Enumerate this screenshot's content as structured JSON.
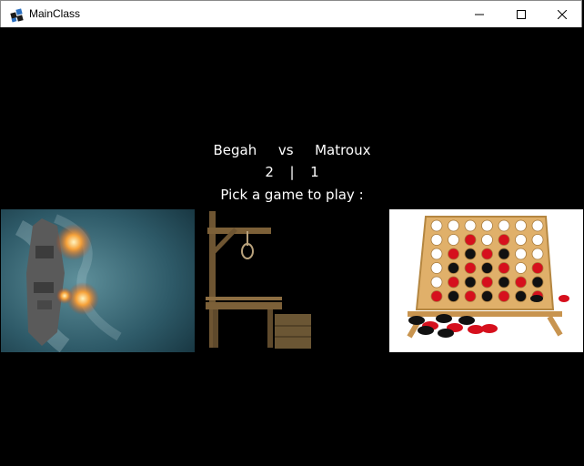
{
  "window": {
    "title": "MainClass",
    "icons": {
      "app": "java-app-icon",
      "minimize": "minimize-icon",
      "maximize": "maximize-icon",
      "close": "close-icon"
    }
  },
  "players": {
    "player1": "Begah",
    "separator": "vs",
    "player2": "Matroux"
  },
  "score": {
    "player1": "2",
    "divider": "|",
    "player2": "1"
  },
  "prompt": "Pick a game to play :",
  "games": [
    {
      "id": "battleship",
      "image": "battleship-image"
    },
    {
      "id": "hangman",
      "image": "hangman-gallows-image"
    },
    {
      "id": "connect-four",
      "image": "connect-four-board-image"
    }
  ],
  "colors": {
    "background": "#000000",
    "text": "#ffffff",
    "checker_red": "#d6101d",
    "checker_black": "#111111",
    "wood": "#d9a85f"
  }
}
